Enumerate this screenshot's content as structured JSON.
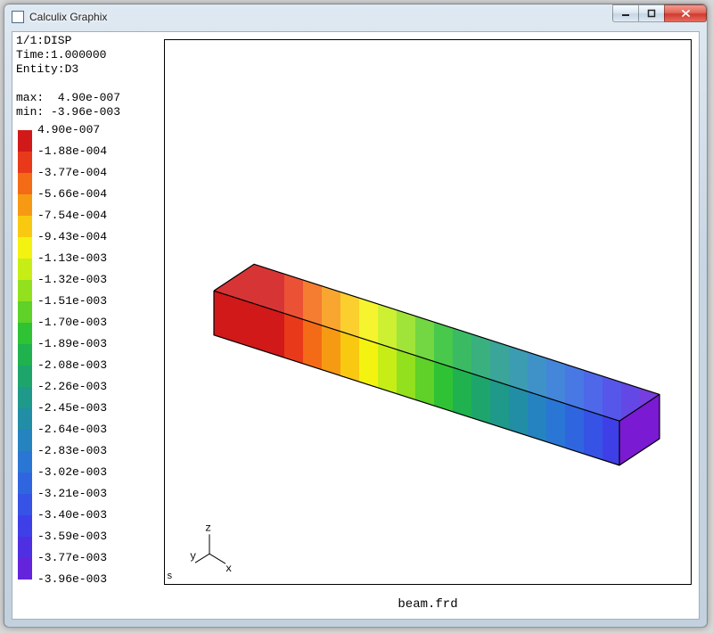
{
  "window": {
    "title": "Calculix Graphix"
  },
  "info": {
    "dataset": "1/1:DISP",
    "time_label": "Time:1.000000",
    "entity": "Entity:D3",
    "max_line": "max:  4.90e-007",
    "min_line": "min: -3.96e-003"
  },
  "legend": [
    {
      "value": " 4.90e-007",
      "color": "#d11919"
    },
    {
      "value": "-1.88e-004",
      "color": "#e83a1a"
    },
    {
      "value": "-3.77e-004",
      "color": "#f36b16"
    },
    {
      "value": "-5.66e-004",
      "color": "#f79a13"
    },
    {
      "value": "-7.54e-004",
      "color": "#f9c911"
    },
    {
      "value": "-9.43e-004",
      "color": "#f4f211"
    },
    {
      "value": "-1.13e-003",
      "color": "#c6ee16"
    },
    {
      "value": "-1.32e-003",
      "color": "#93e01e"
    },
    {
      "value": "-1.51e-003",
      "color": "#5fd128"
    },
    {
      "value": "-1.70e-003",
      "color": "#2fc234"
    },
    {
      "value": "-1.89e-003",
      "color": "#1fb24e"
    },
    {
      "value": "-2.08e-003",
      "color": "#1ea56c"
    },
    {
      "value": "-2.26e-003",
      "color": "#1f998a"
    },
    {
      "value": "-2.45e-003",
      "color": "#218ea6"
    },
    {
      "value": "-2.64e-003",
      "color": "#2583c0"
    },
    {
      "value": "-2.83e-003",
      "color": "#2a76d4"
    },
    {
      "value": "-3.02e-003",
      "color": "#2f66e0"
    },
    {
      "value": "-3.21e-003",
      "color": "#3653e6"
    },
    {
      "value": "-3.40e-003",
      "color": "#3f3fe8"
    },
    {
      "value": "-3.59e-003",
      "color": "#4f2fe2"
    },
    {
      "value": "-3.77e-003",
      "color": "#6324db"
    },
    {
      "value": "-3.96e-003",
      "color": "#7a1ad2"
    }
  ],
  "axes": {
    "z": "z",
    "y": "y",
    "x": "x"
  },
  "corner_marker": "s",
  "filename": "beam.frd"
}
